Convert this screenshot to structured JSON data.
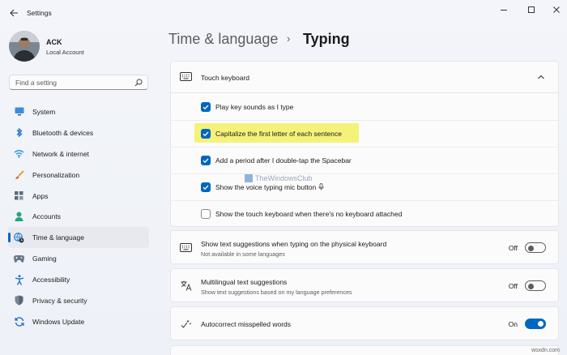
{
  "window": {
    "title": "Settings"
  },
  "profile": {
    "name": "ACK",
    "account_type": "Local Account"
  },
  "search": {
    "placeholder": "Find a setting"
  },
  "sidebar": {
    "items": [
      {
        "label": "System",
        "icon": "monitor-icon",
        "active": false
      },
      {
        "label": "Bluetooth & devices",
        "icon": "bluetooth-icon",
        "active": false
      },
      {
        "label": "Network & internet",
        "icon": "wifi-icon",
        "active": false
      },
      {
        "label": "Personalization",
        "icon": "brush-icon",
        "active": false
      },
      {
        "label": "Apps",
        "icon": "apps-icon",
        "active": false
      },
      {
        "label": "Accounts",
        "icon": "person-icon",
        "active": false
      },
      {
        "label": "Time & language",
        "icon": "globe-clock-icon",
        "active": true
      },
      {
        "label": "Gaming",
        "icon": "gamepad-icon",
        "active": false
      },
      {
        "label": "Accessibility",
        "icon": "accessibility-icon",
        "active": false
      },
      {
        "label": "Privacy & security",
        "icon": "shield-icon",
        "active": false
      },
      {
        "label": "Windows Update",
        "icon": "update-icon",
        "active": false
      }
    ]
  },
  "header": {
    "parent": "Time & language",
    "separator": "›",
    "current": "Typing"
  },
  "touch_keyboard": {
    "title": "Touch keyboard",
    "expanded": true,
    "options": [
      {
        "label": "Play key sounds as I type",
        "checked": true,
        "highlighted": false
      },
      {
        "label": "Capitalize the first letter of each sentence",
        "checked": true,
        "highlighted": true
      },
      {
        "label": "Add a period after I double-tap the Spacebar",
        "checked": true,
        "highlighted": false
      },
      {
        "label": "Show the voice typing mic button",
        "checked": true,
        "highlighted": false
      },
      {
        "label": "Show the touch keyboard when there's no keyboard attached",
        "checked": false,
        "highlighted": false
      }
    ]
  },
  "watermark": {
    "text": "TheWindowsClub"
  },
  "settings_rows": [
    {
      "title": "Show text suggestions when typing on the physical keyboard",
      "subtitle": "Not available in some languages",
      "state": "Off",
      "on": false
    },
    {
      "title": "Multilingual text suggestions",
      "subtitle": "Show text suggestions based on my language preferences",
      "state": "Off",
      "on": false
    },
    {
      "title": "Autocorrect misspelled words",
      "subtitle": "",
      "state": "On",
      "on": true
    }
  ],
  "site_brand": {
    "text": "wsxdn.com"
  },
  "colors": {
    "accent": "#0067c0",
    "highlight": "#f5f27a"
  }
}
